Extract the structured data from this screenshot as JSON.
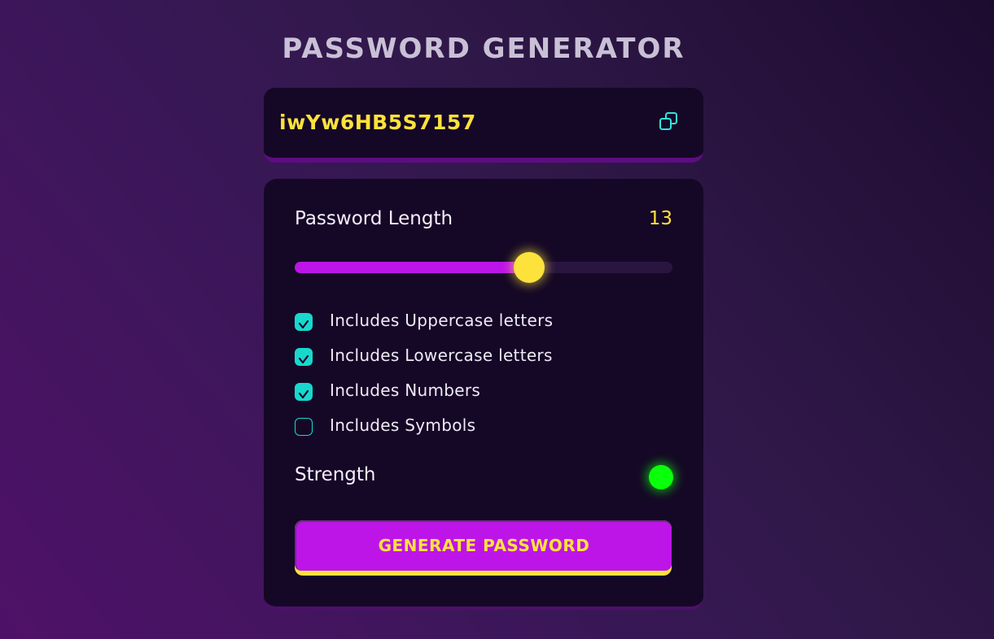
{
  "app": {
    "title": "PASSWORD GENERATOR"
  },
  "display": {
    "password": "iwYw6HB5S7157",
    "copy_icon": "copy-icon"
  },
  "length": {
    "label": "Password Length",
    "value": "13",
    "slider_fill_fraction": 0.62
  },
  "options": [
    {
      "label": "Includes Uppercase letters",
      "checked": true
    },
    {
      "label": "Includes Lowercase letters",
      "checked": true
    },
    {
      "label": "Includes Numbers",
      "checked": true
    },
    {
      "label": "Includes Symbols",
      "checked": false
    }
  ],
  "strength": {
    "label": "Strength",
    "color": "#0aff0a"
  },
  "generate": {
    "label": "GENERATE PASSWORD"
  },
  "colors": {
    "accent_yellow": "#fde23c",
    "accent_purple": "#bd15e8",
    "accent_teal": "#18d8cd",
    "panel_bg": "#150826"
  }
}
